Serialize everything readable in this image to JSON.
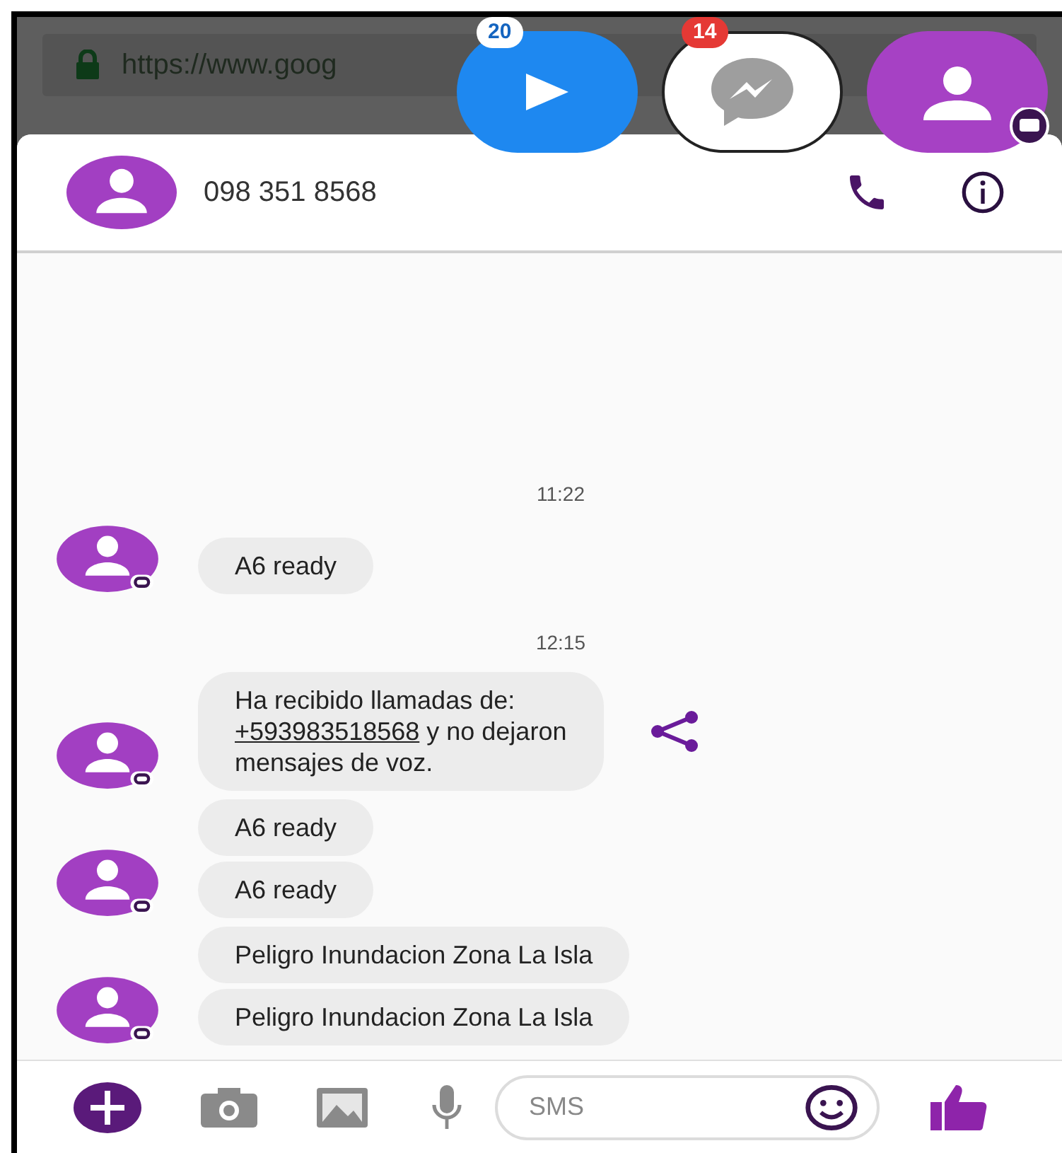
{
  "browser": {
    "url": "https://www.goog"
  },
  "chat_heads": [
    {
      "kind": "play",
      "badge": "20"
    },
    {
      "kind": "messenger",
      "badge": "14"
    },
    {
      "kind": "contact"
    }
  ],
  "header": {
    "contact": "098 351 8568"
  },
  "conversation": [
    {
      "kind": "time",
      "text": "11:22"
    },
    {
      "kind": "group",
      "messages": [
        {
          "parts": [
            {
              "text": "A6 ready"
            }
          ]
        }
      ]
    },
    {
      "kind": "time",
      "text": "12:15"
    },
    {
      "kind": "group",
      "messages": [
        {
          "share": true,
          "parts": [
            {
              "text": "Ha recibido llamadas  de:"
            },
            {
              "kind": "break"
            },
            {
              "kind": "link",
              "text": "+593983518568"
            },
            {
              "text": " y no dejaron"
            },
            {
              "kind": "break"
            },
            {
              "text": "mensajes de voz."
            }
          ]
        }
      ]
    },
    {
      "kind": "group",
      "messages": [
        {
          "parts": [
            {
              "text": "A6 ready"
            }
          ]
        },
        {
          "parts": [
            {
              "text": "A6 ready"
            }
          ]
        }
      ]
    },
    {
      "kind": "group",
      "messages": [
        {
          "parts": [
            {
              "text": "Peligro Inundacion Zona La Isla"
            }
          ]
        },
        {
          "parts": [
            {
              "text": "Peligro Inundacion Zona La Isla"
            }
          ]
        }
      ]
    }
  ],
  "composer": {
    "placeholder": "SMS"
  }
}
